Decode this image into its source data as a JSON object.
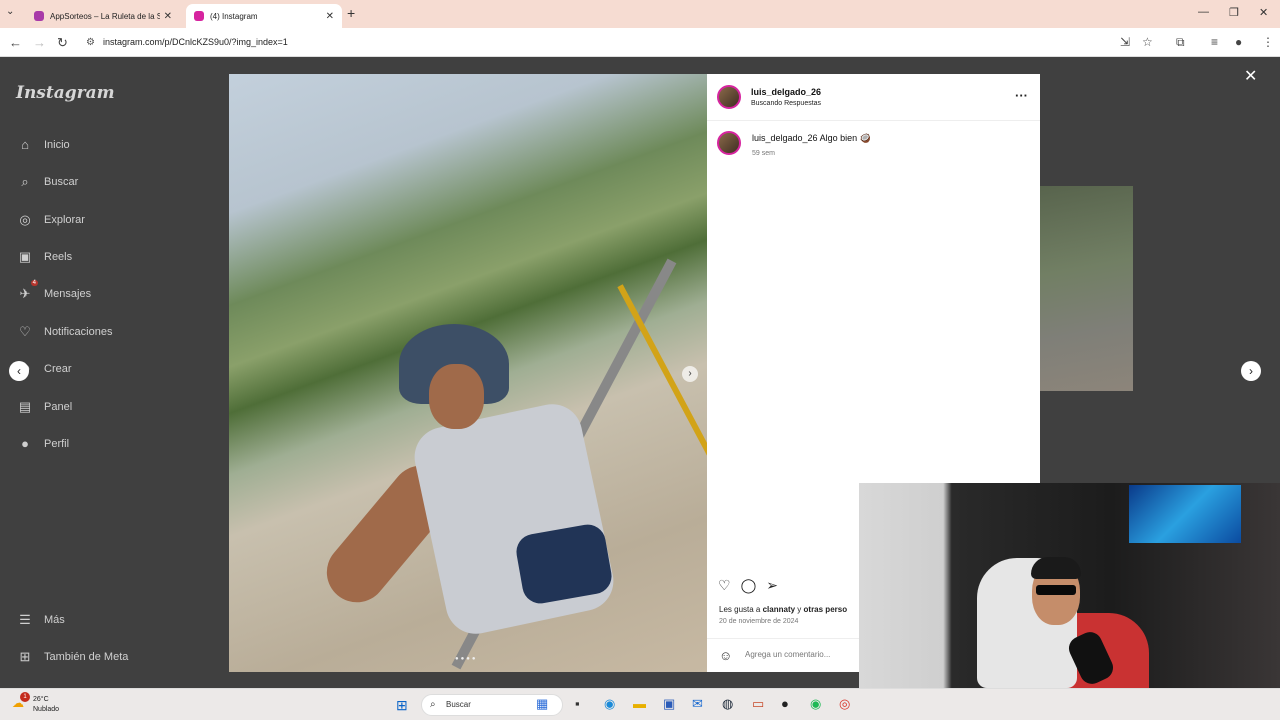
{
  "browser": {
    "tabs": [
      {
        "title": "AppSorteos – La Ruleta de la Su",
        "favicon_color": "#a83aa8"
      },
      {
        "title": "(4) Instagram",
        "favicon_color": "#d6249f"
      }
    ],
    "url": "instagram.com/p/DCnlcKZS9u0/?img_index=1"
  },
  "sidebar": {
    "logo": "Instagram",
    "items": [
      {
        "label": "Inicio",
        "icon": "home-icon"
      },
      {
        "label": "Buscar",
        "icon": "search-icon"
      },
      {
        "label": "Explorar",
        "icon": "compass-icon"
      },
      {
        "label": "Reels",
        "icon": "reels-icon"
      },
      {
        "label": "Mensajes",
        "icon": "messenger-icon",
        "badge": "4"
      },
      {
        "label": "Notificaciones",
        "icon": "heart-icon"
      },
      {
        "label": "Crear",
        "icon": "plus-icon"
      },
      {
        "label": "Panel",
        "icon": "dashboard-icon"
      },
      {
        "label": "Perfil",
        "icon": "avatar-icon"
      }
    ],
    "bottom": [
      {
        "label": "Más",
        "icon": "menu-icon"
      },
      {
        "label": "También de Meta",
        "icon": "meta-icon"
      }
    ]
  },
  "post": {
    "username": "luis_delgado_26",
    "location": "Buscando Respuestas",
    "caption_user": "luis_delgado_26",
    "caption_text": "Algo bien 🥥",
    "time_ago": "59 sem",
    "likes_prefix": "Les gusta a ",
    "likes_user": "clannaty",
    "likes_mid": " y ",
    "likes_others": "otras perso",
    "date": "20 de noviembre de 2024",
    "comment_placeholder": "Agrega un comentario..."
  },
  "taskbar": {
    "weather_temp": "26°C",
    "weather_desc": "Nublado",
    "weather_badge": "1",
    "search_label": "Buscar"
  }
}
